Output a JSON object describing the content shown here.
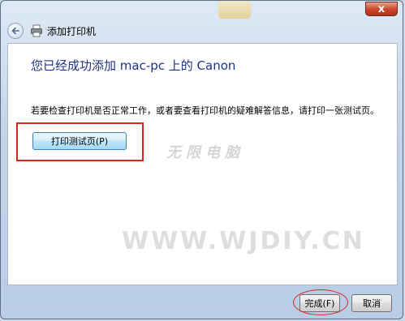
{
  "window": {
    "close_label": "x",
    "nav_title": "添加打印机"
  },
  "main": {
    "heading": "您已经成功添加 mac-pc 上的 Canon",
    "description": "若要检查打印机是否正常工作，或者要查看打印机的疑难解答信息，请打印一张测试页。",
    "print_test_label": "打印测试页(P)"
  },
  "watermark": {
    "text": "WWW.WJDIY.CN",
    "text_top": "无限电脑"
  },
  "footer": {
    "finish_label": "完成(F)",
    "cancel_label": "取消"
  },
  "colors": {
    "heading": "#1e3287",
    "highlight": "#d8261f",
    "close_button": "#c9452a"
  },
  "icons": [
    "back-arrow-icon",
    "printer-icon"
  ]
}
